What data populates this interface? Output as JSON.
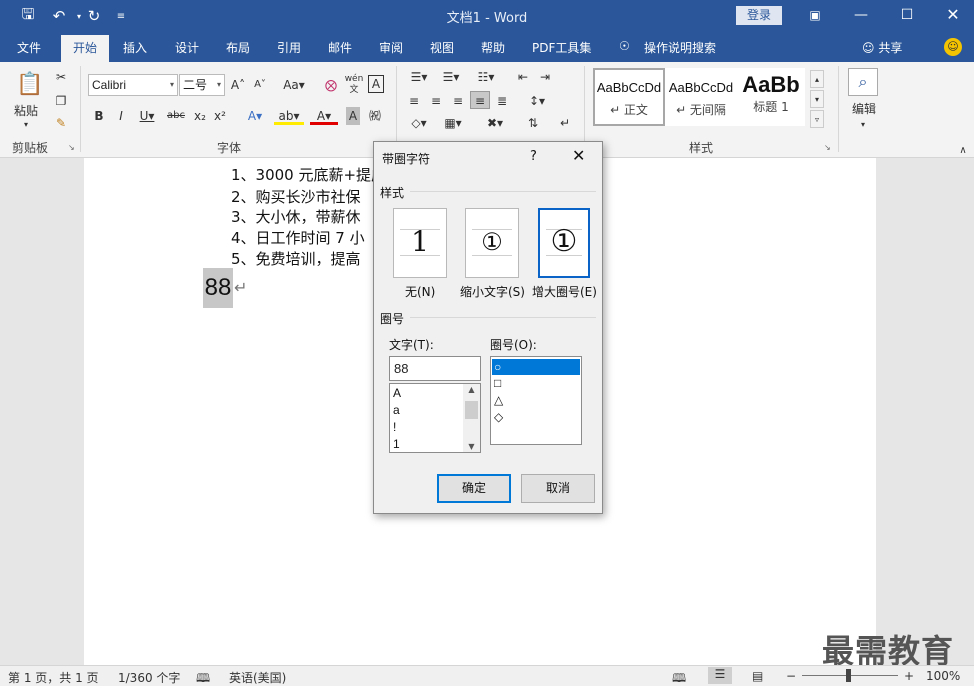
{
  "window": {
    "title": "文档1  -  Word",
    "login_label": "登录"
  },
  "tabs": [
    {
      "label": "文件"
    },
    {
      "label": "开始"
    },
    {
      "label": "插入"
    },
    {
      "label": "设计"
    },
    {
      "label": "布局"
    },
    {
      "label": "引用"
    },
    {
      "label": "邮件"
    },
    {
      "label": "审阅"
    },
    {
      "label": "视图"
    },
    {
      "label": "帮助"
    },
    {
      "label": "PDF工具集"
    },
    {
      "label": "操作说明搜索"
    }
  ],
  "share_label": "共享",
  "ribbon": {
    "paste_label": "粘贴",
    "clipboard_label": "剪贴板",
    "font_group_label": "字体",
    "font_name": "Calibri",
    "font_size": "二号",
    "styles_group_label": "样式",
    "editing_label": "编辑",
    "styles": [
      {
        "sample": "AaBbCcDd",
        "name": "↵ 正文"
      },
      {
        "sample": "AaBbCcDd",
        "name": "↵ 无间隔"
      },
      {
        "sample": "AaBb",
        "name": "标题 1"
      }
    ]
  },
  "document": {
    "lines": [
      "1、3000 元底薪+提成",
      "2、购买长沙市社保",
      "3、大小休，带薪休",
      "4、日工作时间 7 小",
      "5、免费培训，提高"
    ],
    "selected_text": "88"
  },
  "dialog": {
    "title": "带圈字符",
    "help": "?",
    "style_section": "样式",
    "styles": [
      {
        "glyph": "1",
        "label": "无(N)"
      },
      {
        "glyph": "①",
        "label": "缩小文字(S)"
      },
      {
        "glyph": "①",
        "label": "增大圈号(E)"
      }
    ],
    "enclosure_section": "圈号",
    "text_label": "文字(T):",
    "text_value": "88",
    "text_list": [
      "A",
      "a",
      "!",
      "1"
    ],
    "enclosure_label": "圈号(O):",
    "enclosure_list": [
      "○",
      "□",
      "△",
      "◇"
    ],
    "ok_label": "确定",
    "cancel_label": "取消"
  },
  "status": {
    "page": "第 1 页，共 1 页",
    "words": "1/360 个字",
    "language": "英语(美国)",
    "zoom": "100%"
  },
  "watermark": "最需教育"
}
